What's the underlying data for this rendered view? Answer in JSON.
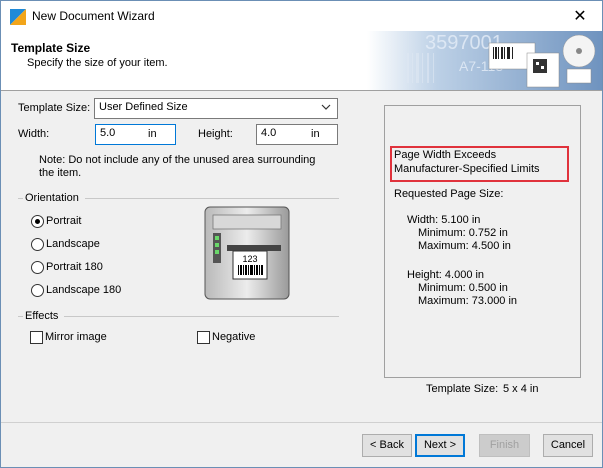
{
  "window": {
    "title": "New Document Wizard",
    "close_label": "✕"
  },
  "header": {
    "title": "Template Size",
    "subtitle": "Specify the size of your item.",
    "banner_number": "3597001",
    "banner_code": "A7-118"
  },
  "form": {
    "template_size_label": "Template Size:",
    "template_size_value": "User Defined Size",
    "width_label": "Width:",
    "width_value": "5.0",
    "width_unit": "in",
    "height_label": "Height:",
    "height_value": "4.0",
    "height_unit": "in",
    "note_line1": "Note: Do not include any of the unused area surrounding",
    "note_line2": "the item."
  },
  "orientation": {
    "label": "Orientation",
    "options": [
      "Portrait",
      "Landscape",
      "Portrait 180",
      "Landscape 180"
    ],
    "selected": "Portrait",
    "printer_label_text": "123"
  },
  "effects": {
    "label": "Effects",
    "mirror_label": "Mirror image",
    "negative_label": "Negative"
  },
  "summary": {
    "warning_line1": "Page Width Exceeds",
    "warning_line2": "Manufacturer-Specified Limits",
    "requested_label": "Requested Page Size:",
    "width_line": "Width: 5.100 in",
    "width_min": "Minimum: 0.752 in",
    "width_max": "Maximum: 4.500 in",
    "height_line": "Height: 4.000 in",
    "height_min": "Minimum: 0.500 in",
    "height_max": "Maximum: 73.000 in",
    "template_size_label": "Template Size:",
    "template_size_value": "5 x 4 in"
  },
  "buttons": {
    "back": "< Back",
    "next": "Next >",
    "finish": "Finish",
    "cancel": "Cancel"
  },
  "colors": {
    "warning_border": "#e0323c",
    "focus": "#0078d7"
  }
}
